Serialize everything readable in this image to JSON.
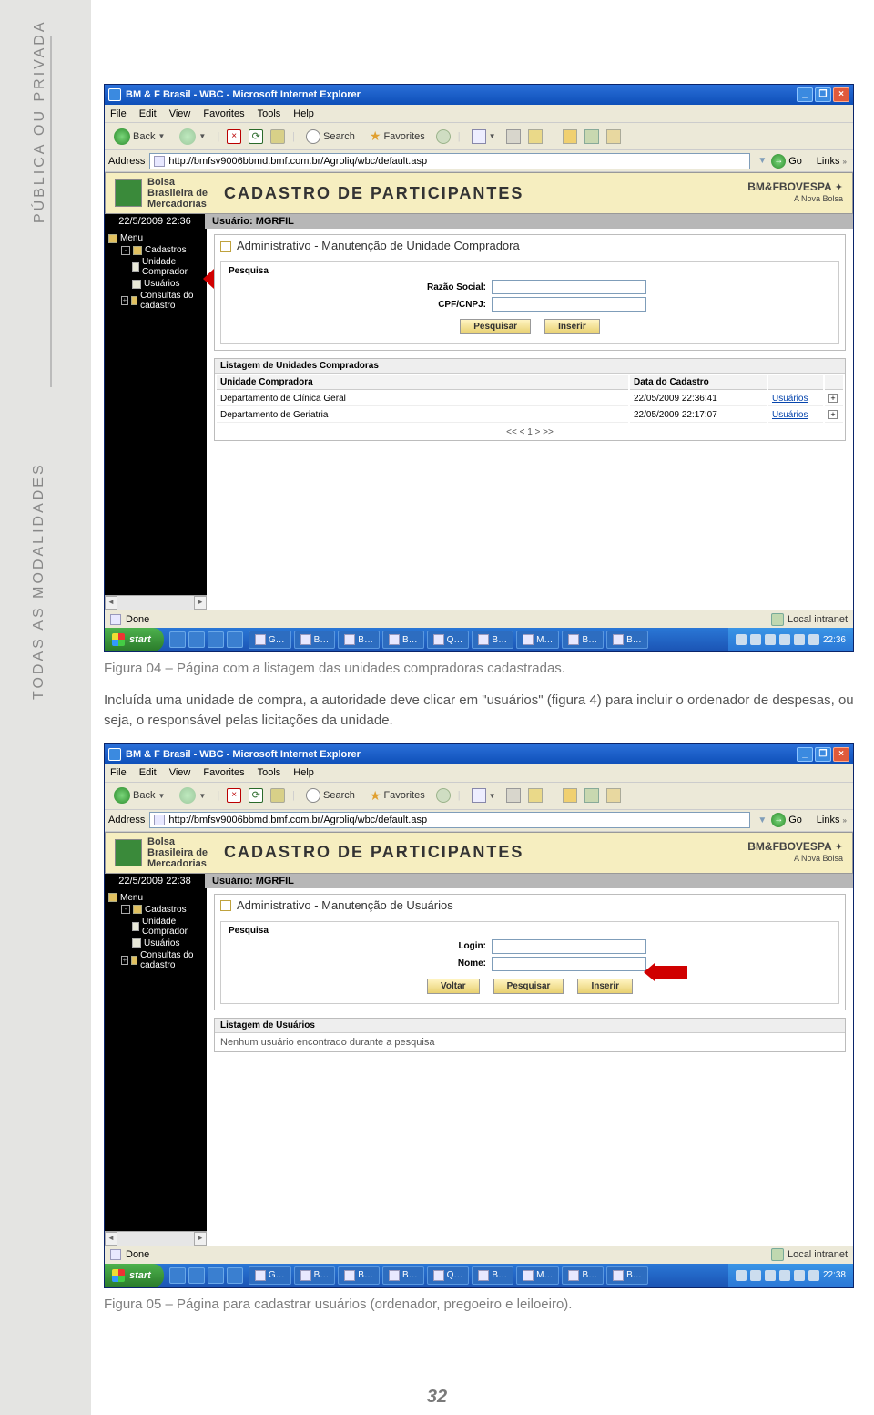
{
  "sidelabels": {
    "top": "PÚBLICA OU PRIVADA",
    "mid": "TODAS AS MODALIDADES"
  },
  "figcap1": "Figura 04 – Página com a listagem das unidades compradoras cadastradas.",
  "bodytext": "Incluída uma unidade de compra, a autoridade deve clicar em \"usuários\" (figura 4) para incluir o ordenador de despesas, ou seja, o responsável pelas licitações da unidade.",
  "figcap2": "Figura 05 – Página para cadastrar usuários (ordenador, pregoeiro e leiloeiro).",
  "pagenum": "32",
  "ie": {
    "title": "BM & F Brasil - WBC - Microsoft Internet Explorer",
    "menus": [
      "File",
      "Edit",
      "View",
      "Favorites",
      "Tools",
      "Help"
    ],
    "back": "Back",
    "search": "Search",
    "favorites": "Favorites",
    "addr_label": "Address",
    "url": "http://bmfsv9006bbmd.bmf.com.br/Agroliq/wbc/default.asp",
    "go": "Go",
    "links": "Links",
    "status_done": "Done",
    "zone": "Local intranet",
    "start": "start"
  },
  "site": {
    "logo_lines": [
      "Bolsa",
      "Brasileira de",
      "Mercadorias"
    ],
    "title": "Cadastro de Participantes",
    "bmf": "BM&FBOVESPA",
    "bmf_sub": "A Nova Bolsa",
    "usuario_label": "Usuário:",
    "usuario": "MGRFIL"
  },
  "screen1": {
    "datetime": "22/5/2009 22:36",
    "tree": {
      "menu": "Menu",
      "cadastros": "Cadastros",
      "unidade": "Unidade Comprador",
      "usuarios": "Usuários",
      "consultas": "Consultas do cadastro"
    },
    "panel_title": "Administrativo - Manutenção de Unidade Compradora",
    "search_title": "Pesquisa",
    "f_razao": "Razão Social:",
    "f_cpf": "CPF/CNPJ:",
    "btn_pesquisar": "Pesquisar",
    "btn_inserir": "Inserir",
    "listing_title": "Listagem de Unidades Compradoras",
    "cols": {
      "unidade": "Unidade Compradora",
      "data": "Data do Cadastro"
    },
    "rows": [
      {
        "nome": "Departamento de Clínica Geral",
        "data": "22/05/2009 22:36:41",
        "link": "Usuários"
      },
      {
        "nome": "Departamento de Geriatria",
        "data": "22/05/2009 22:17:07",
        "link": "Usuários"
      }
    ],
    "pager": "<<   <   1   >   >>",
    "tray_time": "22:36"
  },
  "screen2": {
    "datetime": "22/5/2009 22:38",
    "tree": {
      "menu": "Menu",
      "cadastros": "Cadastros",
      "unidade": "Unidade Comprador",
      "usuarios": "Usuários",
      "consultas": "Consultas do cadastro"
    },
    "panel_title": "Administrativo - Manutenção de Usuários",
    "search_title": "Pesquisa",
    "f_login": "Login:",
    "f_nome": "Nome:",
    "btn_voltar": "Voltar",
    "btn_pesquisar": "Pesquisar",
    "btn_inserir": "Inserir",
    "listing_title": "Listagem de Usuários",
    "msg": "Nenhum usuário encontrado durante a pesquisa",
    "tray_time": "22:38"
  },
  "taskbar_items": [
    "G…",
    "B…",
    "B…",
    "B…",
    "Q…",
    "B…",
    "M…",
    "B…",
    "B…"
  ]
}
